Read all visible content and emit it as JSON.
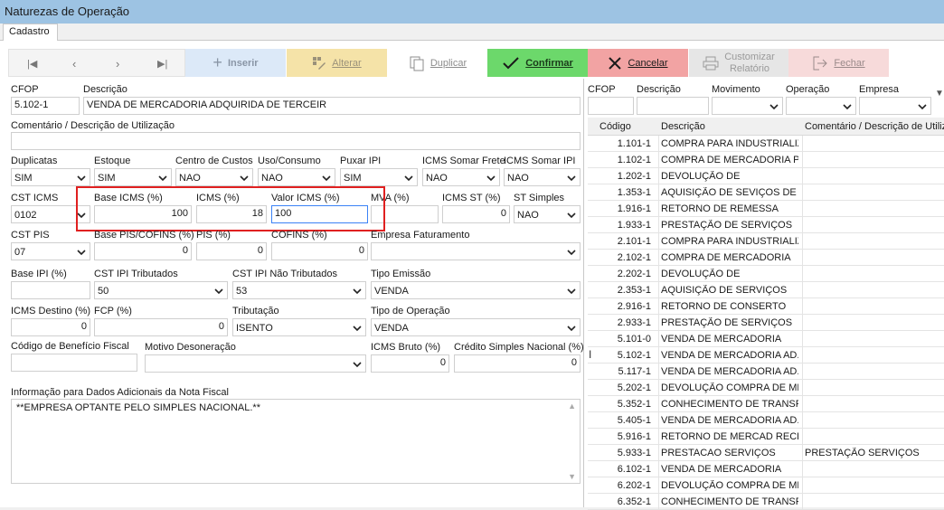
{
  "window": {
    "title": "Naturezas de Operação"
  },
  "tabs": [
    {
      "label": "Cadastro"
    }
  ],
  "toolbar": {
    "inserir": "Inserir",
    "alterar": "Alterar",
    "duplicar": "Duplicar",
    "confirmar": "Confirmar",
    "cancelar": "Cancelar",
    "customizar_line1": "Customizar",
    "customizar_line2": "Relatório",
    "fechar": "Fechar"
  },
  "colors": {
    "confirm_bg": "#6cd86b",
    "cancel_bg": "#f2a3a3",
    "inserir_bg": "#dce9f8",
    "alterar_bg": "#f5e3a8",
    "customizar_bg": "#e6e6e6",
    "fechar_bg": "#f7dada",
    "highlight": "#e02020"
  },
  "form": {
    "cfop": {
      "label": "CFOP",
      "value": "5.102-1"
    },
    "descricao": {
      "label": "Descrição",
      "value": "VENDA DE MERCADORIA ADQUIRIDA DE TERCEIR"
    },
    "comentario": {
      "label": "Comentário / Descrição de Utilização",
      "value": ""
    },
    "duplicatas": {
      "label": "Duplicatas",
      "value": "SIM"
    },
    "estoque": {
      "label": "Estoque",
      "value": "SIM"
    },
    "centro_custos": {
      "label": "Centro de Custos",
      "value": "NAO"
    },
    "uso_consumo": {
      "label": "Uso/Consumo",
      "value": "NAO"
    },
    "puxar_ipi": {
      "label": "Puxar IPI",
      "value": "SIM"
    },
    "icms_somar_frete": {
      "label": "ICMS Somar Frete",
      "value": "NAO"
    },
    "icms_simples": {
      "label": "ICMS Somar IPI",
      "value": "NAO"
    },
    "cst_icms": {
      "label": "CST ICMS",
      "value": "0102"
    },
    "base_icms": {
      "label": "Base ICMS (%)",
      "value": "100"
    },
    "icms": {
      "label": "ICMS (%)",
      "value": "18"
    },
    "valor_icms": {
      "label": "Valor ICMS (%)",
      "value": "100"
    },
    "mva": {
      "label": "MVA (%)",
      "value": ""
    },
    "icms_st": {
      "label": "ICMS ST (%)",
      "value": "0"
    },
    "st_simples": {
      "label": "ST Simples",
      "value": "NAO"
    },
    "cst_pis": {
      "label": "CST PIS",
      "value": "07"
    },
    "base_pis_cofins": {
      "label": "Base PIS/COFINS (%)",
      "value": "0"
    },
    "pis": {
      "label": "PIS (%)",
      "value": "0"
    },
    "cofins": {
      "label": "COFINS (%)",
      "value": "0"
    },
    "empresa_faturamento": {
      "label": "Empresa Faturamento",
      "value": ""
    },
    "base_ipi": {
      "label": "Base IPI (%)",
      "value": ""
    },
    "cst_ipi_trib": {
      "label": "CST IPI Tributados",
      "value": "50"
    },
    "cst_ipi_nao_trib": {
      "label": "CST IPI Não Tributados",
      "value": "53"
    },
    "tipo_emissao": {
      "label": "Tipo Emissão",
      "value": "VENDA"
    },
    "icms_destino": {
      "label": "ICMS Destino (%)",
      "value": "0"
    },
    "fcp": {
      "label": "FCP (%)",
      "value": "0"
    },
    "tributacao": {
      "label": "Tributação",
      "value": "ISENTO"
    },
    "tipo_operacao": {
      "label": "Tipo de Operação",
      "value": "VENDA"
    },
    "codigo_beneficio": {
      "label": "Código de Benefício Fiscal",
      "value": ""
    },
    "motivo_desoneracao": {
      "label": "Motivo Desoneração",
      "value": ""
    },
    "icms_bruto": {
      "label": "ICMS Bruto (%)",
      "value": "0"
    },
    "credito_simples": {
      "label": "Crédito Simples Nacional (%)",
      "value": "0"
    },
    "info_adicionais": {
      "label": "Informação para Dados Adicionais da Nota Fiscal",
      "value": "**EMPRESA OPTANTE PELO SIMPLES NACIONAL.**"
    }
  },
  "right_panel": {
    "filters": {
      "cfop": "CFOP",
      "descricao": "Descrição",
      "movimento": "Movimento",
      "operacao": "Operação",
      "empresa": "Empresa"
    },
    "columns": [
      "Código",
      "Descrição",
      "Comentário / Descrição de Utiliza"
    ],
    "rows": [
      [
        "1.101-1",
        "COMPRA PARA INDUSTRIALIZ...",
        ""
      ],
      [
        "1.102-1",
        "COMPRA DE MERCADORIA P...",
        ""
      ],
      [
        "1.202-1",
        "DEVOLUÇÃO DE",
        ""
      ],
      [
        "1.353-1",
        "AQUISIÇÃO DE SEVIÇOS DE ...",
        ""
      ],
      [
        "1.916-1",
        "RETORNO DE REMESSA",
        ""
      ],
      [
        "1.933-1",
        "PRESTAÇÃO DE SERVIÇOS",
        ""
      ],
      [
        "2.101-1",
        "COMPRA PARA INDUSTRIALIZ...",
        ""
      ],
      [
        "2.102-1",
        "COMPRA DE MERCADORIA",
        ""
      ],
      [
        "2.202-1",
        "DEVOLUÇÃO DE",
        ""
      ],
      [
        "2.353-1",
        "AQUISIÇÃO DE SERVIÇOS",
        ""
      ],
      [
        "2.916-1",
        "RETORNO DE CONSERTO",
        ""
      ],
      [
        "2.933-1",
        "PRESTAÇÃO DE SERVIÇOS",
        ""
      ],
      [
        "5.101-0",
        "VENDA DE MERCADORIA",
        ""
      ],
      [
        "5.102-1",
        "VENDA DE MERCADORIA AD...",
        ""
      ],
      [
        "5.117-1",
        "VENDA DE MERCADORIA AD...",
        ""
      ],
      [
        "5.202-1",
        "DEVOLUÇÃO COMPRA DE ME...",
        ""
      ],
      [
        "5.352-1",
        "CONHECIMENTO DE TRANSP...",
        ""
      ],
      [
        "5.405-1",
        "VENDA DE MERCADORIA AD...",
        ""
      ],
      [
        "5.916-1",
        "RETORNO DE MERCAD RECE...",
        ""
      ],
      [
        "5.933-1",
        "PRESTACAO SERVIÇOS",
        "PRESTAÇÃO SERVIÇOS"
      ],
      [
        "6.102-1",
        "VENDA DE MERCADORIA",
        ""
      ],
      [
        "6.202-1",
        "DEVOLUÇÃO COMPRA DE ME...",
        ""
      ],
      [
        "6.352-1",
        "CONHECIMENTO DE TRANSP...",
        ""
      ]
    ]
  }
}
